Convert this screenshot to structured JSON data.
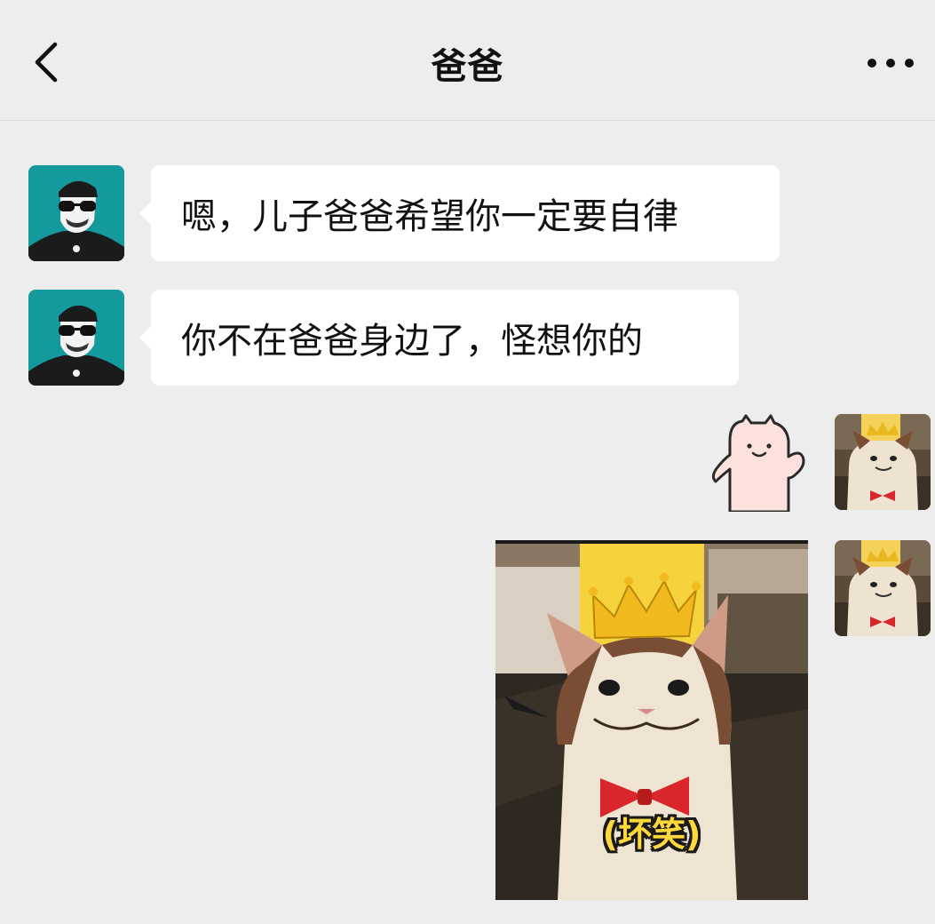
{
  "header": {
    "title": "爸爸",
    "back_icon": "chevron-left-icon",
    "more_icon": "more-horizontal-icon"
  },
  "messages": [
    {
      "sender": "contact",
      "type": "text",
      "text": "嗯，儿子爸爸希望你一定要自律"
    },
    {
      "sender": "contact",
      "type": "text",
      "text": "你不在爸爸身边了，怪想你的"
    },
    {
      "sender": "me",
      "type": "sticker",
      "sticker": "waving-pink-cat-sticker"
    },
    {
      "sender": "me",
      "type": "image",
      "caption": "(坏笑)",
      "image": "crowned-cat-with-bowtie"
    }
  ],
  "colors": {
    "background": "#ededed",
    "bubble": "#ffffff",
    "contact_avatar_bg": "#149a9c",
    "caption": "#ffd93b"
  }
}
